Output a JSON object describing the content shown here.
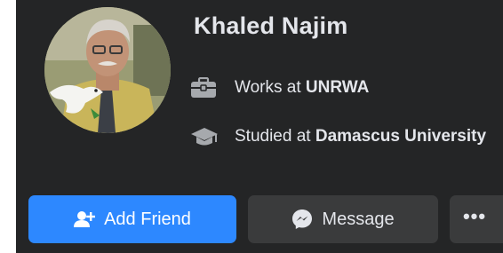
{
  "profile": {
    "name": "Khaled Najim",
    "work_prefix": "Works at ",
    "work_place": "UNRWA",
    "edu_prefix": "Studied at ",
    "edu_place": "Damascus University"
  },
  "actions": {
    "add_friend_label": "Add Friend",
    "message_label": "Message",
    "more_label": "•••"
  },
  "icons": {
    "work": "briefcase-icon",
    "education": "graduation-cap-icon",
    "add_friend": "add-friend-icon",
    "message": "messenger-icon"
  },
  "colors": {
    "card_background": "#242526",
    "primary_button": "#2d88ff",
    "secondary_button": "#3a3b3c",
    "text": "#e4e6eb"
  }
}
